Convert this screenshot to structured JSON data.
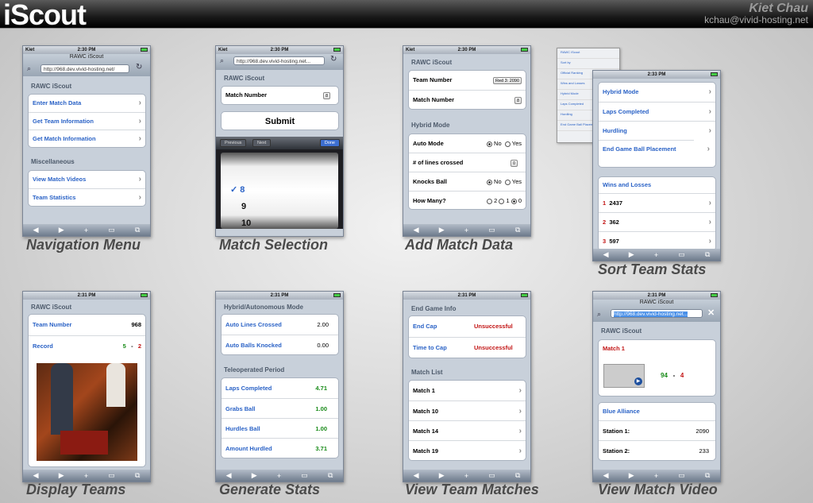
{
  "header": {
    "title": "iScout",
    "author": "Kiet Chau",
    "email": "kchau@vivid-hosting.net"
  },
  "status": {
    "carrier": "Kiet",
    "times": [
      "2:30 PM",
      "2:31 PM",
      "2:33 PM"
    ]
  },
  "screens": {
    "nav": {
      "caption": "Navigation Menu",
      "title": "RAWC iScout",
      "url": "http://968.dev.vivid-hosting.net/",
      "group1": "RAWC iScout",
      "items1": [
        "Enter Match Data",
        "Get Team Information",
        "Get Match Information"
      ],
      "group2": "Miscellaneous",
      "items2": [
        "View Match Videos",
        "Team Statistics"
      ]
    },
    "match": {
      "caption": "Match Selection",
      "url": "http://968.dev.vivid-hosting.net...",
      "group": "RAWC iScout",
      "label": "Match Number",
      "value": "8",
      "submit": "Submit",
      "prev": "Previous",
      "next": "Next",
      "done": "Done",
      "picker": [
        "8",
        "9",
        "10"
      ]
    },
    "add": {
      "caption": "Add Match Data",
      "group1": "RAWC iScout",
      "team_label": "Team Number",
      "team_value": "Red 3: 2090",
      "match_label": "Match Number",
      "match_value": "8",
      "group2": "Hybrid Mode",
      "auto": "Auto Mode",
      "lines": "# of lines crossed",
      "lines_value": "0",
      "knocks": "Knocks Ball",
      "howmany": "How Many?",
      "no": "No",
      "yes": "Yes",
      "n2": "2",
      "n1": "1",
      "n0": "0"
    },
    "sort": {
      "caption": "Sort Team Stats",
      "items": [
        "Hybrid Mode",
        "Laps Completed",
        "Hurdling",
        "End Game Ball Placement"
      ],
      "group": "Wins and Losses",
      "ranks": [
        {
          "rank": "1",
          "team": "2437"
        },
        {
          "rank": "2",
          "team": "362"
        },
        {
          "rank": "3",
          "team": "597"
        }
      ],
      "mini": [
        "RAWC iScout",
        "Sort by",
        "Official Ranking",
        "Wins and Losses",
        "Hybrid Mode",
        "Laps Completed",
        "Hurdling",
        "End Game Ball Placement"
      ]
    },
    "teams": {
      "caption": "Display Teams",
      "group": "RAWC iScout",
      "team_label": "Team Number",
      "team_value": "968",
      "record_label": "Record",
      "wins": "5",
      "dash": "-",
      "losses": "2"
    },
    "stats": {
      "caption": "Generate Stats",
      "group1": "Hybrid/Autonomous Mode",
      "a1": "Auto Lines Crossed",
      "v1": "2.00",
      "a2": "Auto Balls Knocked",
      "v2": "0.00",
      "group2": "Teleoperated Period",
      "b1": "Laps Completed",
      "w1": "4.71",
      "b2": "Grabs Ball",
      "w2": "1.00",
      "b3": "Hurdles Ball",
      "w3": "1.00",
      "b4": "Amount Hurdled",
      "w4": "3.71"
    },
    "matches": {
      "caption": "View Team Matches",
      "group1": "End Game Info",
      "e1": "End Cap",
      "ev1": "Unsuccessful",
      "e2": "Time to Cap",
      "ev2": "Unsuccessful",
      "group2": "Match List",
      "list": [
        "Match 1",
        "Match 10",
        "Match 14",
        "Match 19"
      ]
    },
    "video": {
      "caption": "View Match Video",
      "title": "RAWC iScout",
      "url": "http://968.dev.vivid-hosting.net...",
      "group": "RAWC iScout",
      "match": "Match 1",
      "blue_score": "94",
      "dash": "-",
      "red_score": "4",
      "alliance": "Blue Alliance",
      "s1": "Station 1:",
      "s1v": "2090",
      "s2": "Station 2:",
      "s2v": "233"
    }
  }
}
